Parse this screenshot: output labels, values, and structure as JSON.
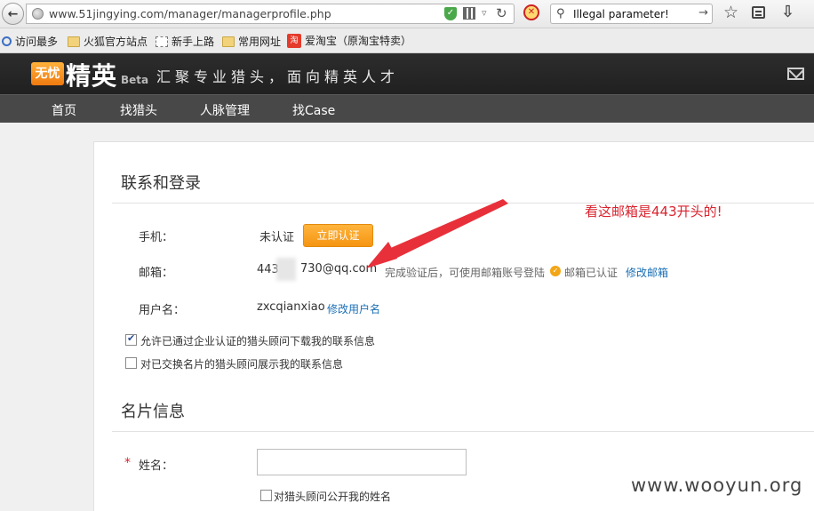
{
  "browser": {
    "url": "www.51jingying.com/manager/managerprofile.php",
    "search_value": "Illegal parameter!",
    "bookmarks": [
      "访问最多",
      "火狐官方站点",
      "新手上路",
      "常用网址",
      "爱淘宝（原淘宝特卖）"
    ],
    "taobao_glyph": "淘"
  },
  "site": {
    "logo_badge": "无忧",
    "logo_main": "精英",
    "logo_beta": "Beta",
    "slogan": "汇聚专业猎头，面向精英人才",
    "nav": [
      "首页",
      "找猎头",
      "人脉管理",
      "找Case"
    ]
  },
  "contact_section": {
    "title": "联系和登录",
    "phone_label": "手机：",
    "phone_status": "未认证",
    "verify_button": "立即认证",
    "email_label": "邮箱：",
    "email_prefix": "443",
    "email_suffix": "730@qq.com",
    "email_hint": "完成验证后，可使用邮箱账号登陆",
    "email_verified": "邮箱已认证",
    "edit_email": "修改邮箱",
    "username_label": "用户名：",
    "username": "zxcqianxiao",
    "edit_username": "修改用户名",
    "option1": "允许已通过企业认证的猎头顾问下载我的联系信息",
    "option1_checked": true,
    "option2": "对已交换名片的猎头顾问展示我的联系信息",
    "option2_checked": false
  },
  "card_section": {
    "title": "名片信息",
    "required_mark": "*",
    "name_label": "姓名：",
    "name_value": "",
    "public_name_option": "对猎头顾问公开我的姓名"
  },
  "annotation": "看这邮箱是443开头的!",
  "watermark": "www.wooyun.org",
  "colors": {
    "accent": "#f59512",
    "annotation": "#d9232e",
    "link": "#1a6fb5"
  }
}
